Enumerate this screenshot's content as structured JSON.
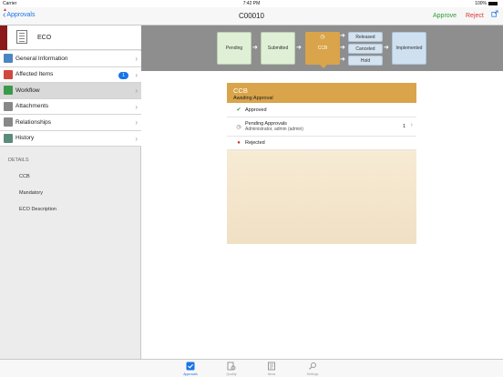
{
  "status_bar": {
    "carrier": "Carrier",
    "time": "7:42 PM",
    "battery": "100%"
  },
  "nav": {
    "back_label": "Approvals",
    "title": "C00010",
    "approve_label": "Approve",
    "reject_label": "Reject"
  },
  "sidebar": {
    "header_label": "ECO",
    "items": [
      {
        "label": "General Information",
        "icon": "info-icon",
        "color": "#4a87c2"
      },
      {
        "label": "Affected Items",
        "icon": "affected-items-icon",
        "color": "#d0493e",
        "badge": "1"
      },
      {
        "label": "Workflow",
        "icon": "workflow-icon",
        "color": "#3a9a4a"
      },
      {
        "label": "Attachments",
        "icon": "attachments-icon",
        "color": "#888888"
      },
      {
        "label": "Relationships",
        "icon": "relationships-icon",
        "color": "#888888"
      },
      {
        "label": "History",
        "icon": "history-icon",
        "color": "#5a8c7a"
      }
    ],
    "details_heading": "DETAILS",
    "details": [
      "CCB",
      "Mandatory",
      "ECO Description"
    ]
  },
  "workflow": {
    "stages": {
      "pending": "Pending",
      "submitted": "Submitted",
      "ccb": "CCB",
      "released": "Released",
      "canceled": "Canceled",
      "hold": "Hold",
      "implemented": "Implemented"
    },
    "colors": {
      "current": "#d9a44a",
      "completed": "#dff0d6",
      "future": "#cfe0f0"
    }
  },
  "approval_card": {
    "title": "CCB",
    "subtitle": "Awaiting Approval",
    "approved_label": "Approved",
    "pending_label": "Pending Approvals",
    "pending_names": "Administrator, admin (admin)",
    "pending_count": "1",
    "rejected_label": "Rejected"
  },
  "tabs": [
    {
      "label": "Approvals",
      "icon": "approvals-icon"
    },
    {
      "label": "Quality",
      "icon": "quality-icon"
    },
    {
      "label": "Items",
      "icon": "items-icon"
    },
    {
      "label": "Settings",
      "icon": "settings-icon"
    }
  ]
}
